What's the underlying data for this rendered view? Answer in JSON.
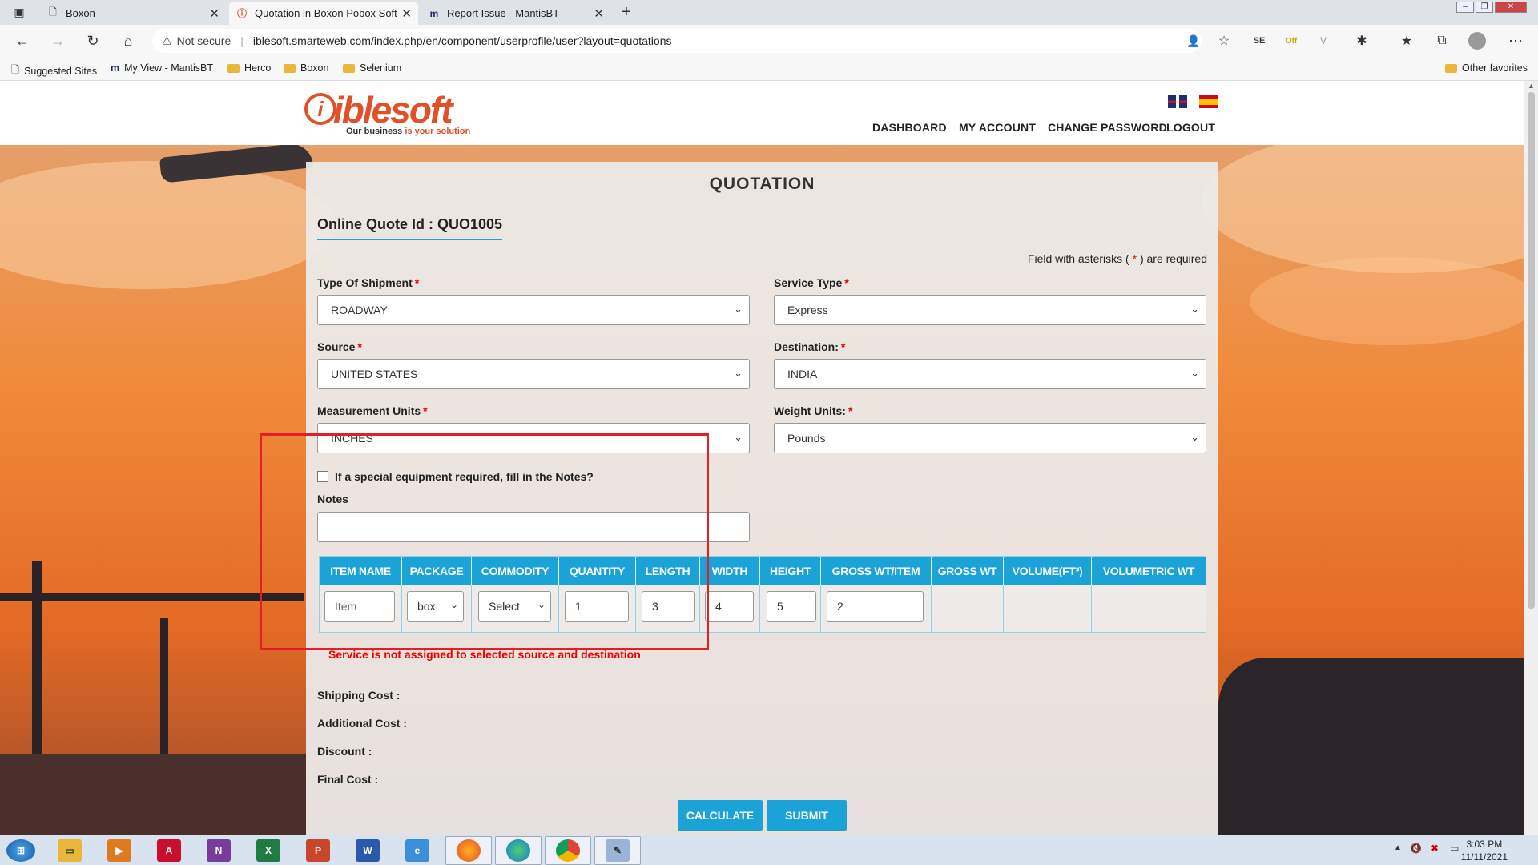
{
  "browser": {
    "tabs": [
      {
        "title": "Boxon"
      },
      {
        "title": "Quotation in Boxon Pobox Softw"
      },
      {
        "title": "Report Issue - MantisBT"
      }
    ],
    "security_label": "Not secure",
    "url": "iblesoft.smarteweb.com/index.php/en/component/userprofile/user?layout=quotations",
    "bookmarks": [
      "Suggested Sites",
      "My View - MantisBT",
      "Herco",
      "Boxon",
      "Selenium"
    ],
    "other_favorites": "Other favorites"
  },
  "site": {
    "logo_text": "iblesoft",
    "logo_tagline_a": "Our business",
    "logo_tagline_b": " is your solution",
    "menu": [
      "DASHBOARD",
      "MY ACCOUNT",
      "CHANGE PASSWORD",
      "LOGOUT"
    ]
  },
  "form": {
    "title": "QUOTATION",
    "quote_id": "Online Quote Id : QUO1005",
    "required_note_a": "Field with asterisks (",
    "required_note_star": " * ",
    "required_note_b": ") are required",
    "fields": {
      "shipment_type": {
        "label": "Type Of Shipment",
        "value": "ROADWAY"
      },
      "service_type": {
        "label": "Service Type",
        "value": "Express"
      },
      "source": {
        "label": "Source",
        "value": "UNITED STATES"
      },
      "destination": {
        "label": "Destination:",
        "value": "INDIA"
      },
      "measurement_units": {
        "label": "Measurement Units",
        "value": "INCHES"
      },
      "weight_units": {
        "label": "Weight Units:",
        "value": "Pounds"
      }
    },
    "special_equipment_label": "If a special equipment required, fill in the Notes?",
    "notes_label": "Notes",
    "table": {
      "headers": [
        "ITEM NAME",
        "PACKAGE",
        "COMMODITY",
        "QUANTITY",
        "LENGTH",
        "WIDTH",
        "HEIGHT",
        "GROSS WT/ITEM",
        "GROSS WT",
        "VOLUME(FT³)",
        "VOLUMETRIC WT"
      ],
      "row": {
        "item_name_placeholder": "Item",
        "package": "box",
        "commodity": "Select",
        "quantity": "1",
        "length": "3",
        "width": "4",
        "height": "5",
        "gross_wt_item": "2"
      }
    },
    "error": "Service is not assigned to selected source and destination",
    "costs": {
      "shipping": "Shipping Cost :",
      "additional": "Additional Cost :",
      "discount": "Discount :",
      "final": "Final Cost :"
    },
    "buttons": {
      "calculate": "CALCULATE",
      "submit": "SUBMIT"
    }
  },
  "taskbar": {
    "time": "3:03 PM",
    "date": "11/11/2021"
  },
  "colors": {
    "accent": "#1ba3d8",
    "error": "#e00000",
    "annotation": "#e21e26"
  }
}
